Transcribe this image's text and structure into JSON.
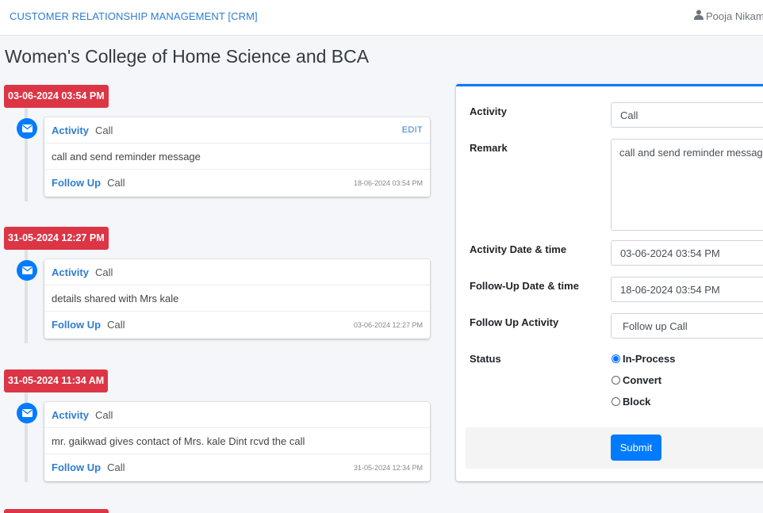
{
  "header": {
    "brand": "CUSTOMER RELATIONSHIP MANAGEMENT [CRM]",
    "user_name": "Pooja Nikam",
    "user_icon": "user-icon"
  },
  "page": {
    "title": "Women's College of Home Science and BCA"
  },
  "timeline": [
    {
      "time_label": "03-06-2024 03:54 PM",
      "activity_label": "Activity",
      "activity_value": "Call",
      "edit_label": "EDIT",
      "remark": "call and send reminder message",
      "followup_label": "Follow Up",
      "followup_value": "Call",
      "followup_time": "18-06-2024 03:54 PM",
      "icon": "envelope-icon"
    },
    {
      "time_label": "31-05-2024 12:27 PM",
      "activity_label": "Activity",
      "activity_value": "Call",
      "remark": "details shared with Mrs kale",
      "followup_label": "Follow Up",
      "followup_value": "Call",
      "followup_time": "03-06-2024 12:27 PM",
      "icon": "envelope-icon"
    },
    {
      "time_label": "31-05-2024 11:34 AM",
      "activity_label": "Activity",
      "activity_value": "Call",
      "remark": "mr. gaikwad gives contact of Mrs. kale Dint rcvd the call",
      "followup_label": "Follow Up",
      "followup_value": "Call",
      "followup_time": "31-05-2024 12:34 PM",
      "icon": "envelope-icon"
    }
  ],
  "form": {
    "activity_label": "Activity",
    "activity_value": "Call",
    "remark_label": "Remark",
    "remark_value": "call and send reminder message",
    "activity_dt_label": "Activity Date & time",
    "activity_dt_value": "03-06-2024 03:54 PM",
    "followup_dt_label": "Follow-Up Date & time",
    "followup_dt_value": "18-06-2024 03:54 PM",
    "followup_activity_label": "Follow Up Activity",
    "followup_activity_value": "Follow up Call",
    "status_label": "Status",
    "status_options": [
      "In-Process",
      "Convert",
      "Block"
    ],
    "status_selected": "In-Process",
    "submit_label": "Submit"
  },
  "colors": {
    "accent": "#007bff",
    "time_label": "#dc3545",
    "link": "#2f7dd1"
  }
}
